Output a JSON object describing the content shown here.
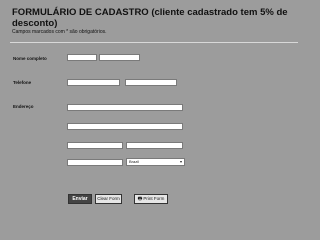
{
  "form": {
    "title": "FORMULÁRIO DE CADASTRO (cliente cadastrado tem 5% de desconto)",
    "required_note": "Campos marcados com * são obrigatórios.",
    "labels": {
      "name": "Nome completo",
      "phone": "Telefone",
      "address": "Endereço"
    },
    "country_select": {
      "selected": "Brazil"
    },
    "buttons": {
      "send": "Enviar",
      "clear": "Clear Form",
      "print": "Print Form"
    }
  },
  "icons": {
    "print": "printer-icon",
    "dropdown": "chevron-down-icon"
  }
}
